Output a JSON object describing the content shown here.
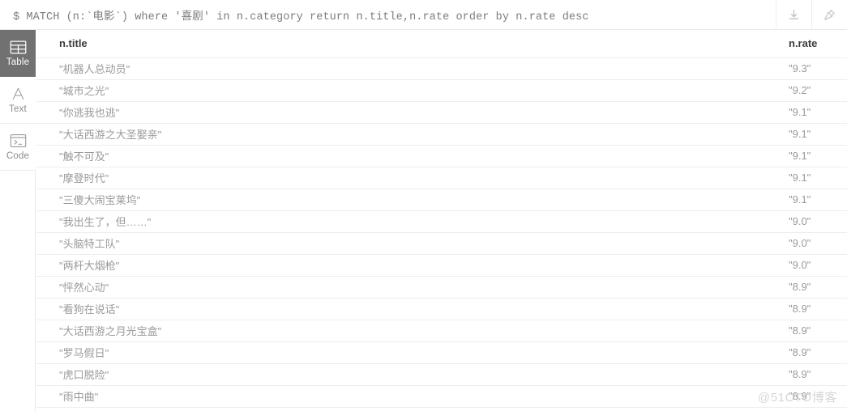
{
  "query_bar": {
    "query": "$ MATCH (n:`电影`) where '喜剧' in n.category return n.title,n.rate order by n.rate desc",
    "download_title": "Download",
    "pin_title": "Pin"
  },
  "sidebar": {
    "items": [
      {
        "label": "Table",
        "icon": "table-icon",
        "active": true
      },
      {
        "label": "Text",
        "icon": "text-icon",
        "active": false
      },
      {
        "label": "Code",
        "icon": "code-icon",
        "active": false
      }
    ]
  },
  "results_table": {
    "columns": [
      "n.title",
      "n.rate"
    ],
    "rows": [
      {
        "title": "\"机器人总动员\"",
        "rate": "\"9.3\""
      },
      {
        "title": "\"城市之光\"",
        "rate": "\"9.2\""
      },
      {
        "title": "\"你逃我也逃\"",
        "rate": "\"9.1\""
      },
      {
        "title": "\"大话西游之大圣娶亲\"",
        "rate": "\"9.1\""
      },
      {
        "title": "\"触不可及\"",
        "rate": "\"9.1\""
      },
      {
        "title": "\"摩登时代\"",
        "rate": "\"9.1\""
      },
      {
        "title": "\"三傻大闹宝莱坞\"",
        "rate": "\"9.1\""
      },
      {
        "title": "\"我出生了，但……\"",
        "rate": "\"9.0\""
      },
      {
        "title": "\"头脑特工队\"",
        "rate": "\"9.0\""
      },
      {
        "title": "\"两杆大烟枪\"",
        "rate": "\"9.0\""
      },
      {
        "title": "\"怦然心动\"",
        "rate": "\"8.9\""
      },
      {
        "title": "\"看狗在说话\"",
        "rate": "\"8.9\""
      },
      {
        "title": "\"大话西游之月光宝盒\"",
        "rate": "\"8.9\""
      },
      {
        "title": "\"罗马假日\"",
        "rate": "\"8.9\""
      },
      {
        "title": "\"虎口脱险\"",
        "rate": "\"8.9\""
      },
      {
        "title": "\"雨中曲\"",
        "rate": "\"8.9\""
      }
    ]
  },
  "watermark": {
    "text": "@51CTO博客"
  },
  "colors": {
    "active_sidebar_bg": "#717171",
    "border": "#ededed",
    "query_text": "#7d7d7d",
    "cell_text": "#9a9a9a",
    "header_text": "#3b3b3b"
  }
}
